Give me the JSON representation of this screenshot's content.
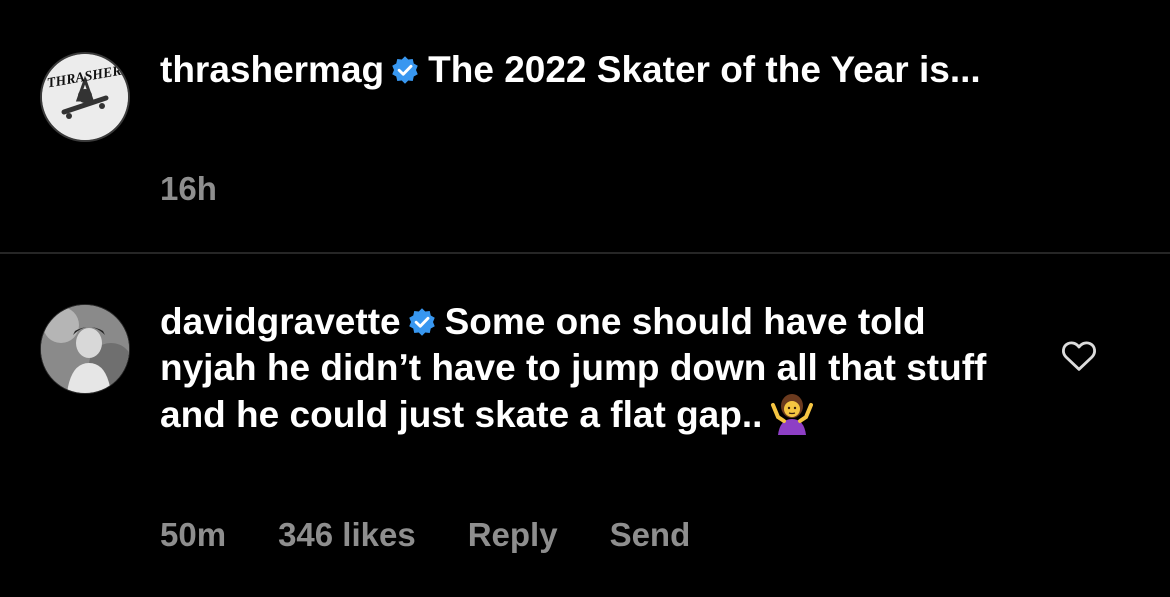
{
  "post": {
    "username": "thrashermag",
    "caption": "The 2022 Skater of the Year is...",
    "time": "16h",
    "avatar_logo_text": "THRASHER"
  },
  "comment": {
    "username": "davidgravette",
    "text": "Some one should have told nyjah he didn’t have to jump down all that stuff and he could just skate a flat gap..",
    "emoji": "🤷‍♀️",
    "time": "50m",
    "likes": "346 likes",
    "reply_label": "Reply",
    "send_label": "Send"
  },
  "icons": {
    "verified": "verified-badge-icon",
    "like": "heart-outline-icon"
  },
  "colors": {
    "background": "#000000",
    "text": "#ffffff",
    "meta": "#8e8e8e",
    "verified": "#3897f0"
  }
}
